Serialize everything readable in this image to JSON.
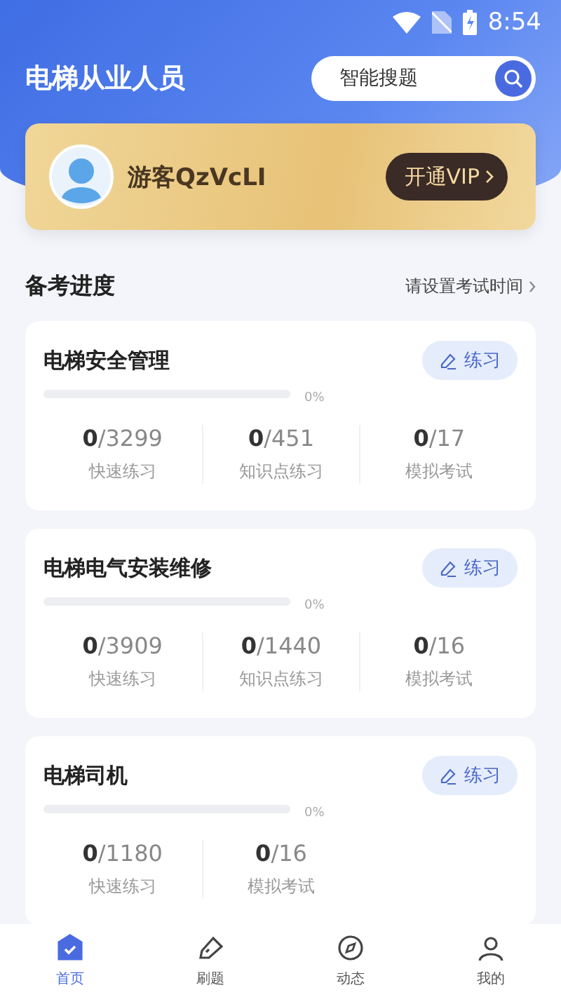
{
  "status_bar": {
    "time": "8:54"
  },
  "header": {
    "title": "电梯从业人员",
    "search": {
      "placeholder": "智能搜题"
    }
  },
  "vip_card": {
    "user_name": "游客QzVcLI",
    "button": "开通VIP"
  },
  "section": {
    "title": "备考进度",
    "action": "请设置考试时间"
  },
  "courses": [
    {
      "title": "电梯安全管理",
      "button": "练习",
      "level": 0,
      "percent": "0%",
      "stats": [
        {
          "done": "0",
          "total": "/3299",
          "label": "快速练习"
        },
        {
          "done": "0",
          "total": "/451",
          "label": "知识点练习"
        },
        {
          "done": "0",
          "total": "/17",
          "label": "模拟考试"
        }
      ]
    },
    {
      "title": "电梯电气安装维修",
      "button": "练习",
      "level": 0,
      "percent": "0%",
      "stats": [
        {
          "done": "0",
          "total": "/3909",
          "label": "快速练习"
        },
        {
          "done": "0",
          "total": "/1440",
          "label": "知识点练习"
        },
        {
          "done": "0",
          "total": "/16",
          "label": "模拟考试"
        }
      ]
    },
    {
      "title": "电梯司机",
      "button": "练习",
      "level": 0,
      "percent": "0%",
      "stats": [
        {
          "done": "0",
          "total": "/1180",
          "label": "快速练习"
        },
        {
          "done": "0",
          "total": "/16",
          "label": "模拟考试"
        }
      ]
    }
  ],
  "tab_bar": [
    {
      "label": "首页",
      "kind": "home",
      "selected": true
    },
    {
      "label": "刷题",
      "kind": "practice",
      "selected": false
    },
    {
      "label": "动态",
      "kind": "feed",
      "selected": false
    },
    {
      "label": "我的",
      "kind": "me",
      "selected": false
    }
  ]
}
